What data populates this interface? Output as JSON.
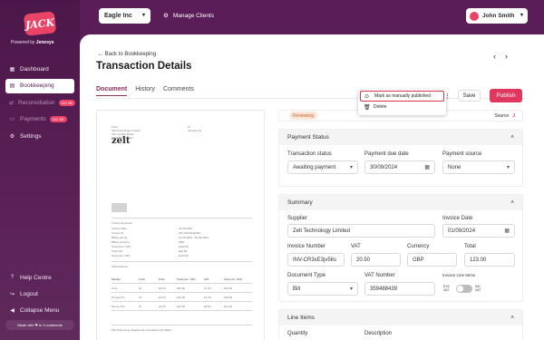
{
  "brand": {
    "logo": "JACK",
    "powered_by": "Powered by",
    "powered_brand": "Jenesys"
  },
  "sidebar": {
    "items": [
      {
        "label": "Dashboard",
        "icon": "grid-icon"
      },
      {
        "label": "Bookkeeping",
        "icon": "book-icon"
      },
      {
        "label": "Reconciliation",
        "icon": "swap-icon",
        "badge": "GO SE"
      },
      {
        "label": "Payments",
        "icon": "card-icon",
        "badge": "GO SE"
      },
      {
        "label": "Settings",
        "icon": "gear-icon"
      }
    ],
    "bottom": [
      {
        "label": "Help Centre",
        "icon": "help-icon"
      },
      {
        "label": "Logout",
        "icon": "logout-icon"
      },
      {
        "label": "Collapse Menu",
        "icon": "collapse-icon"
      }
    ],
    "made_with": "Made with ❤ in 3 continents"
  },
  "topbar": {
    "client": "Eagle Inc",
    "manage_clients": "Manage Clients",
    "user": "John Smith"
  },
  "page": {
    "back": "Back to Bookkeeping",
    "title": "Transaction Details",
    "tabs": [
      "Document",
      "History",
      "Comments"
    ],
    "save": "Save",
    "publish": "Publish"
  },
  "dropdown": {
    "items": [
      "Mark as manually published",
      "Delete"
    ]
  },
  "status": {
    "badge": "Reviewing",
    "source_label": "Source"
  },
  "payment_status": {
    "title": "Payment Status",
    "transaction_status_label": "Transaction status",
    "transaction_status": "Awaiting payment",
    "due_date_label": "Payment due date",
    "due_date": "30/09/2024",
    "source_label": "Payment source",
    "source": "None"
  },
  "summary": {
    "title": "Summary",
    "supplier_label": "Supplier",
    "supplier": "Zelt Technology Limited",
    "invoice_date_label": "Invoice Date",
    "invoice_date": "01/09/2024",
    "invoice_number_label": "Invoice Number",
    "invoice_number": "INV-CR3xE3jv56s",
    "vat_label": "VAT",
    "vat": "20.50",
    "currency_label": "Currency",
    "currency": "GBP",
    "total_label": "Total",
    "total": "123.00",
    "doc_type_label": "Document Type",
    "doc_type": "Bill",
    "vat_number_label": "VAT Number",
    "vat_number": "359488439",
    "line_items_toggle_label": "Invoice Line Items",
    "toggle_left": "EXC VAT",
    "toggle_right": "INC VAT"
  },
  "line_items": {
    "title": "Line Items",
    "quantity_label": "Quantity",
    "description_label": "Description"
  },
  "document": {
    "logo": "zelt",
    "from_lines": [
      "From",
      "Zelt Technology Limited",
      "Iron Lumber Bolan",
      "SE918ES London"
    ],
    "to_lines": [
      "To",
      "Jenesys Ut"
    ],
    "summary_header": "Invoice Summary",
    "summary_rows": [
      [
        "Invoice Date",
        "01.09.2024"
      ],
      [
        "Invoice ID",
        "INV-CR3xE3jv56s"
      ],
      [
        "Billing period",
        "01.09.2024 - 30.09.2024"
      ],
      [
        "Billing currency",
        "GBP"
      ],
      [
        "Total (excl. VAT)",
        "£102.50"
      ],
      [
        "Total VAT",
        "£20.50"
      ],
      [
        "Total (incl. VAT)",
        "£123.00"
      ]
    ],
    "subs_header": "Subscriptions",
    "table_head": [
      "Module",
      "Units",
      "Price",
      "Total (exc. VAT)",
      "VAT",
      "Total (inc. VAT)"
    ],
    "table_rows": [
      [
        "Core",
        "10",
        "£3.00",
        "£30.00",
        "£7.00",
        "£36.00"
      ],
      [
        "People Pro",
        "10",
        "£3.00",
        "£30.00",
        "£7.00",
        "£36.00"
      ],
      [
        "Money Pro",
        "10",
        "£4.25",
        "£42.50",
        "£8.50",
        "£51.00"
      ]
    ],
    "footer": "Zelt Technology Registered in England and Wales"
  },
  "colors": {
    "primary": "#5a1d57",
    "accent": "#e0375e",
    "reviewing_bg": "#fde6d8"
  }
}
